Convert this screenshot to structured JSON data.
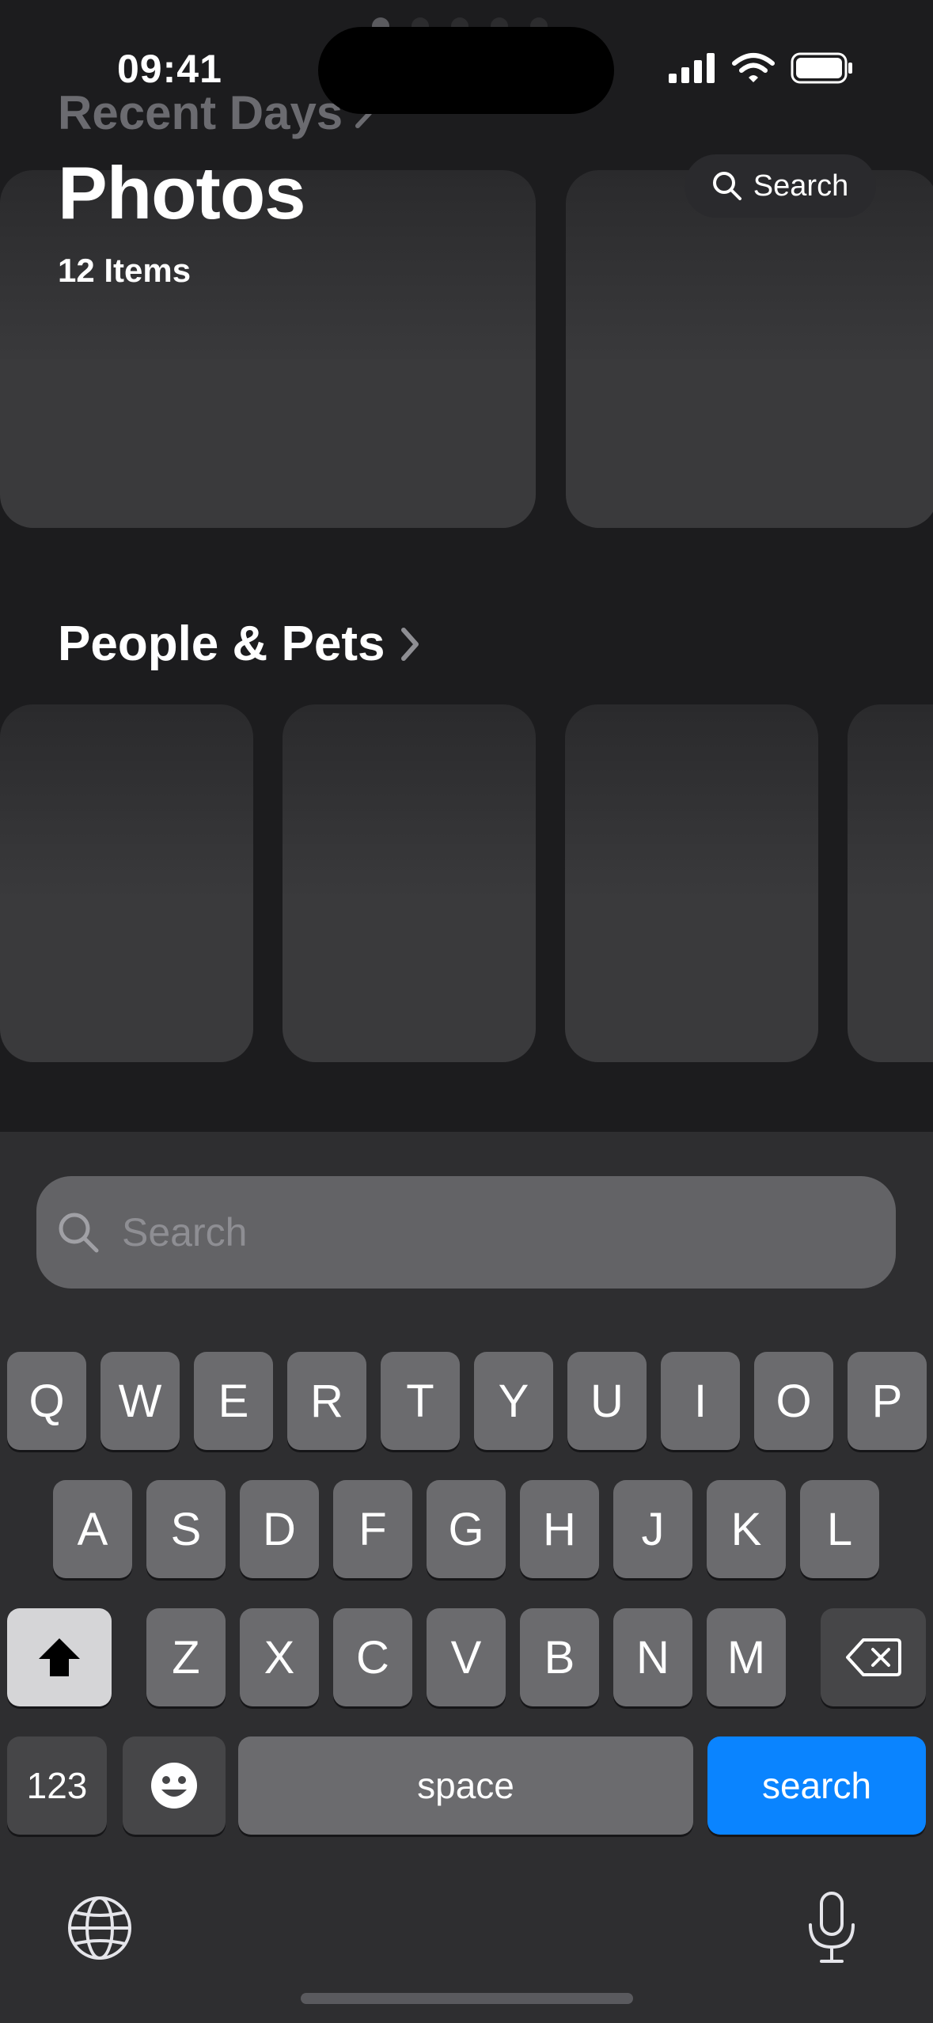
{
  "status_bar": {
    "time": "09:41"
  },
  "header": {
    "recent_days": "Recent Days",
    "title": "Photos",
    "items_count": "12 Items",
    "search_button": "Search"
  },
  "sections": {
    "people_pets": "People & Pets"
  },
  "search_field": {
    "placeholder": "Search",
    "value": ""
  },
  "keyboard": {
    "row1": [
      "Q",
      "W",
      "E",
      "R",
      "T",
      "Y",
      "U",
      "I",
      "O",
      "P"
    ],
    "row2": [
      "A",
      "S",
      "D",
      "F",
      "G",
      "H",
      "J",
      "K",
      "L"
    ],
    "row3": [
      "Z",
      "X",
      "C",
      "V",
      "B",
      "N",
      "M"
    ],
    "numbers_key": "123",
    "space_key": "space",
    "return_key": "search"
  },
  "colors": {
    "accent": "#0a84ff",
    "background": "#1c1c1e"
  },
  "icons": [
    "signal-icon",
    "wifi-icon",
    "battery-icon",
    "chevron-right-icon",
    "search-icon",
    "shift-icon",
    "delete-icon",
    "emoji-icon",
    "globe-icon",
    "microphone-icon"
  ]
}
